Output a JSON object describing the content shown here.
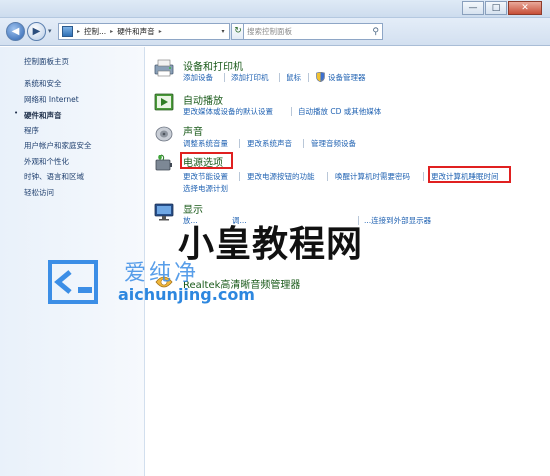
{
  "window": {
    "minimize_glyph": "—",
    "maximize_glyph": "□",
    "close_glyph": "✕"
  },
  "address_bar": {
    "back_glyph": "◀",
    "forward_glyph": "▶",
    "history_glyph": "▾",
    "crumbs": [
      "控制...",
      "硬件和声音"
    ],
    "separator_glyph": "▸",
    "dropdown_glyph": "▾",
    "refresh_glyph": "↻",
    "search_placeholder": "搜索控制面板",
    "search_glyph": "⚲"
  },
  "sidebar": {
    "items": [
      {
        "label": "控制面板主页"
      },
      {
        "label": "系统和安全"
      },
      {
        "label": "网络和 Internet"
      },
      {
        "label": "硬件和声音",
        "current": true
      },
      {
        "label": "程序"
      },
      {
        "label": "用户帐户和家庭安全"
      },
      {
        "label": "外观和个性化"
      },
      {
        "label": "时钟、语言和区域"
      },
      {
        "label": "轻松访问"
      }
    ],
    "current_bullet": "•"
  },
  "categories": {
    "devices": {
      "title": "设备和打印机",
      "tasks": [
        "添加设备",
        "添加打印机",
        "鼠标",
        "设备管理器"
      ],
      "icon": "printer-icon"
    },
    "autoplay": {
      "title": "自动播放",
      "tasks": [
        "更改媒体或设备的默认设置",
        "自动播放 CD 或其他媒体"
      ],
      "icon": "autoplay-icon"
    },
    "sound": {
      "title": "声音",
      "tasks": [
        "调整系统音量",
        "更改系统声音",
        "管理音频设备"
      ],
      "icon": "speaker-icon"
    },
    "power": {
      "title": "电源选项",
      "tasks": [
        "更改节能设置",
        "更改电源按钮的功能",
        "唤醒计算机时需要密码",
        "更改计算机睡眠时间",
        "选择电源计划"
      ],
      "icon": "power-icon"
    },
    "display": {
      "title": "显示",
      "tasks": [
        "放...",
        "调...",
        "...连接到外部显示器"
      ],
      "icon": "display-icon"
    },
    "realtek": {
      "title": "Realtek高清晰音频管理器",
      "icon": "realtek-icon"
    }
  },
  "watermark": {
    "site_name": "小皇教程网",
    "brand": "爱纯净",
    "url": "aichunjing.com"
  },
  "colors": {
    "link": "#2364b3",
    "category_title": "#1a5a1a",
    "highlight_box": "#e02020"
  }
}
